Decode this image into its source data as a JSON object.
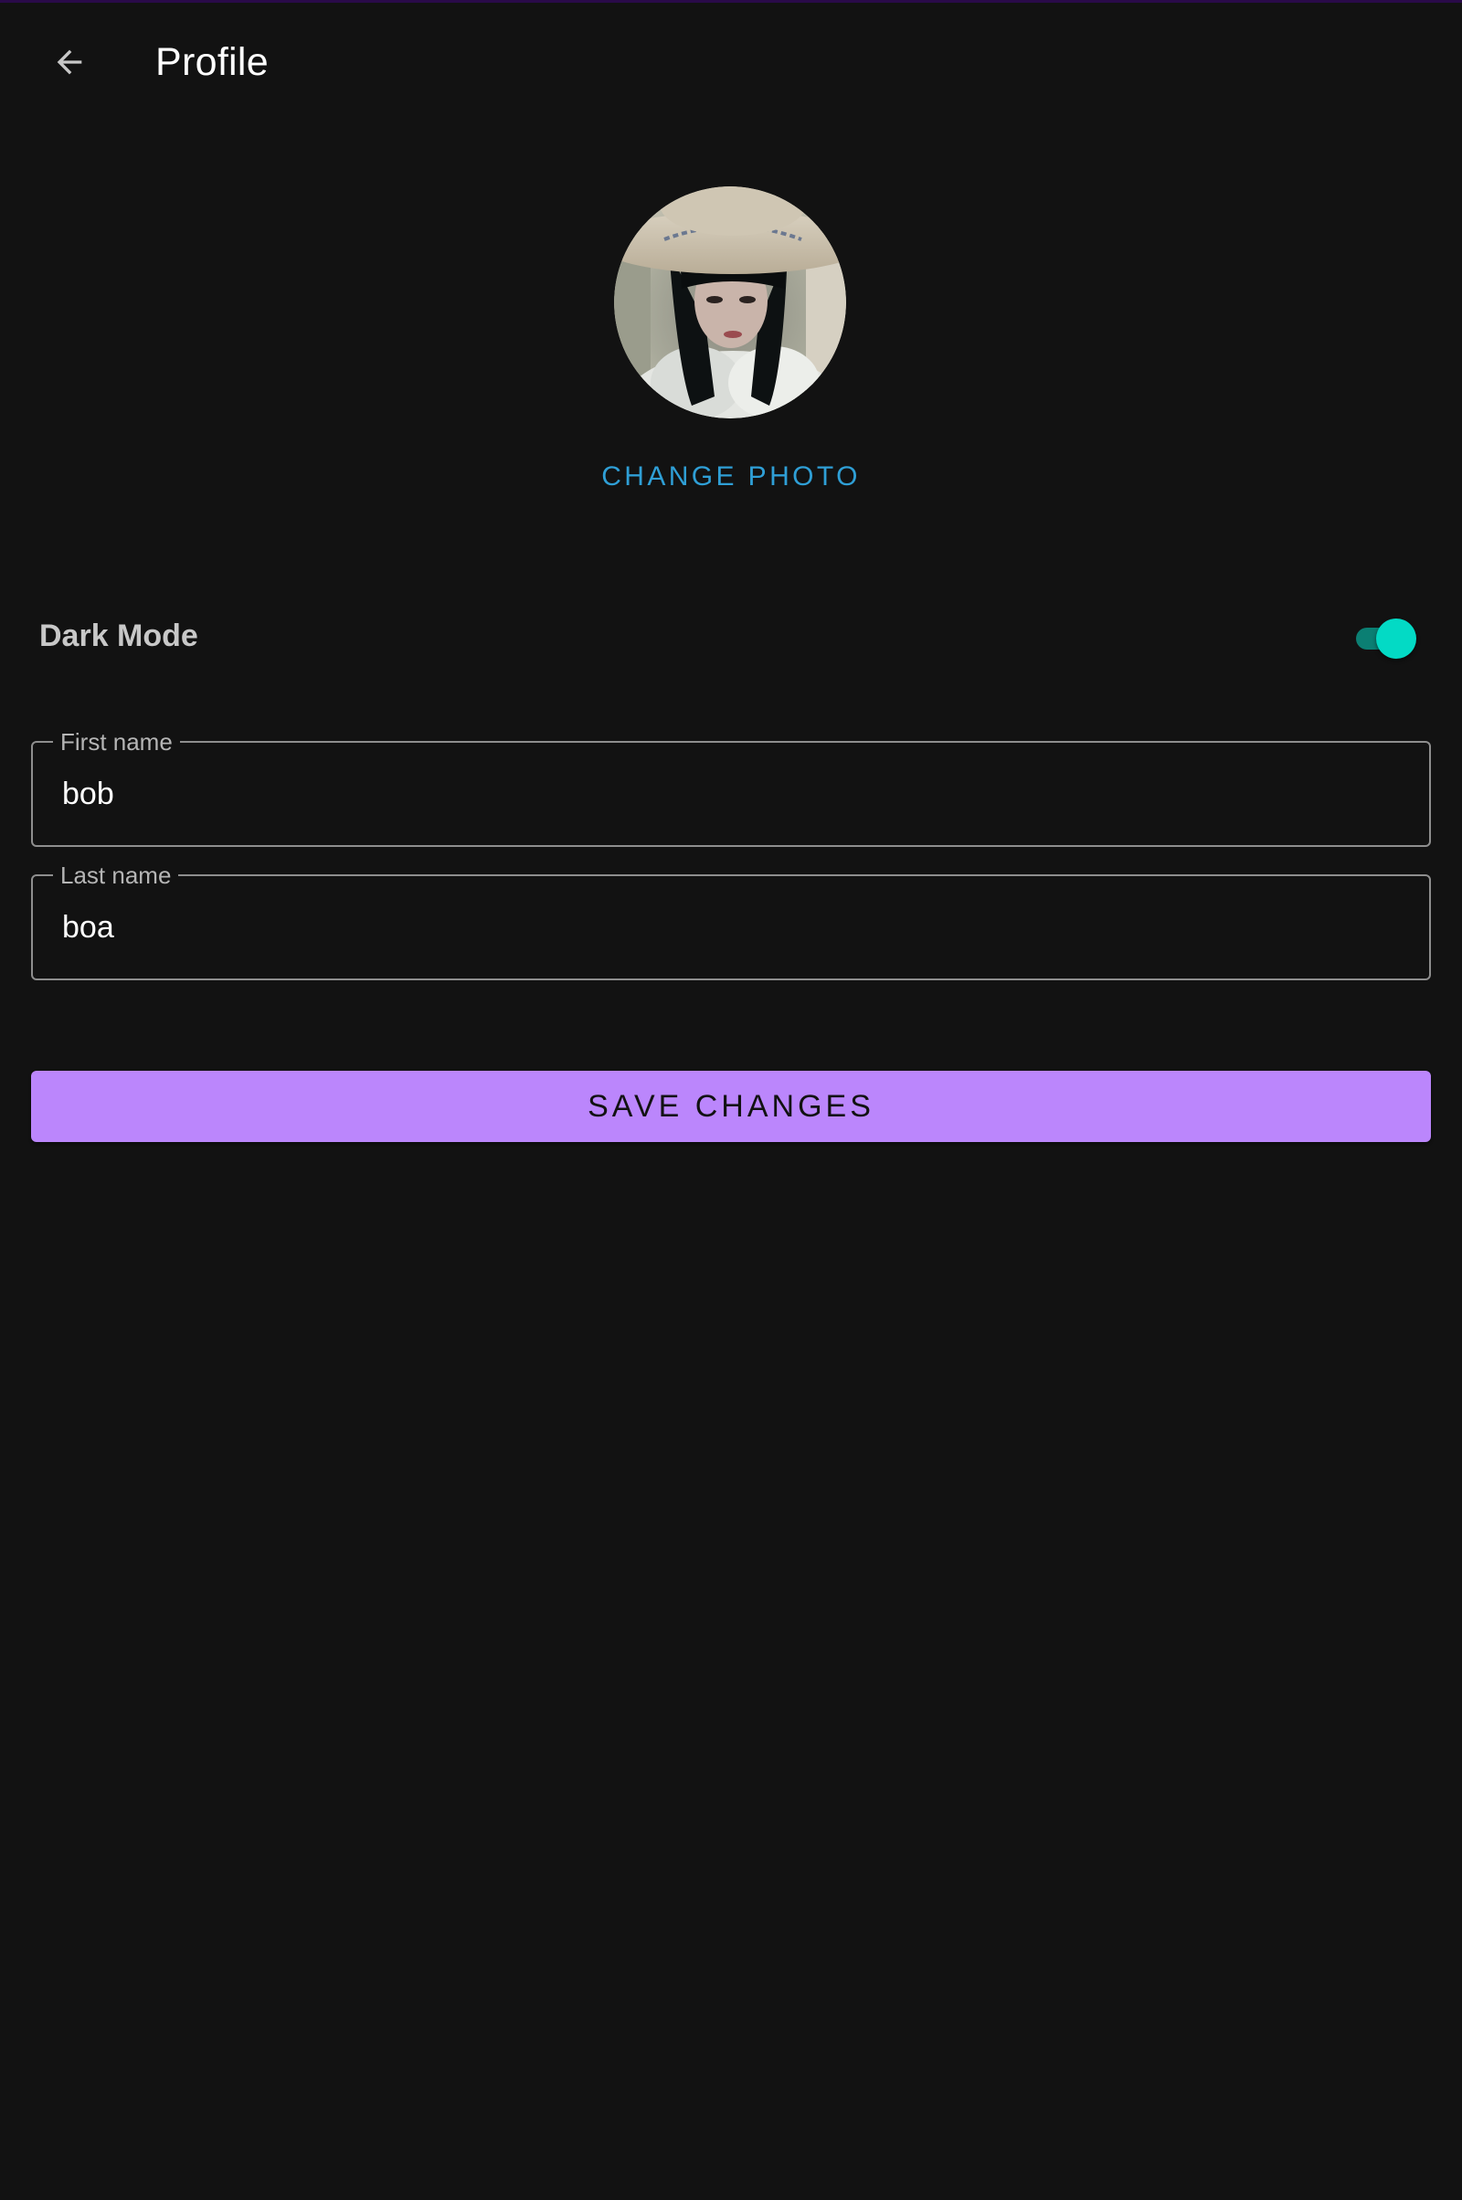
{
  "app_bar": {
    "title": "Profile",
    "back_icon": "arrow-back-icon"
  },
  "profile": {
    "avatar_alt": "profile photo",
    "change_photo_label": "CHANGE PHOTO"
  },
  "settings": {
    "dark_mode_label": "Dark Mode",
    "dark_mode_enabled": true
  },
  "form": {
    "first_name": {
      "label": "First name",
      "value": "bob"
    },
    "last_name": {
      "label": "Last name",
      "value": "boa"
    },
    "save_label": "SAVE CHANGES"
  },
  "colors": {
    "background": "#121212",
    "primary": "#bb86fc",
    "secondary": "#03dac5",
    "link": "#2f9fd6"
  }
}
